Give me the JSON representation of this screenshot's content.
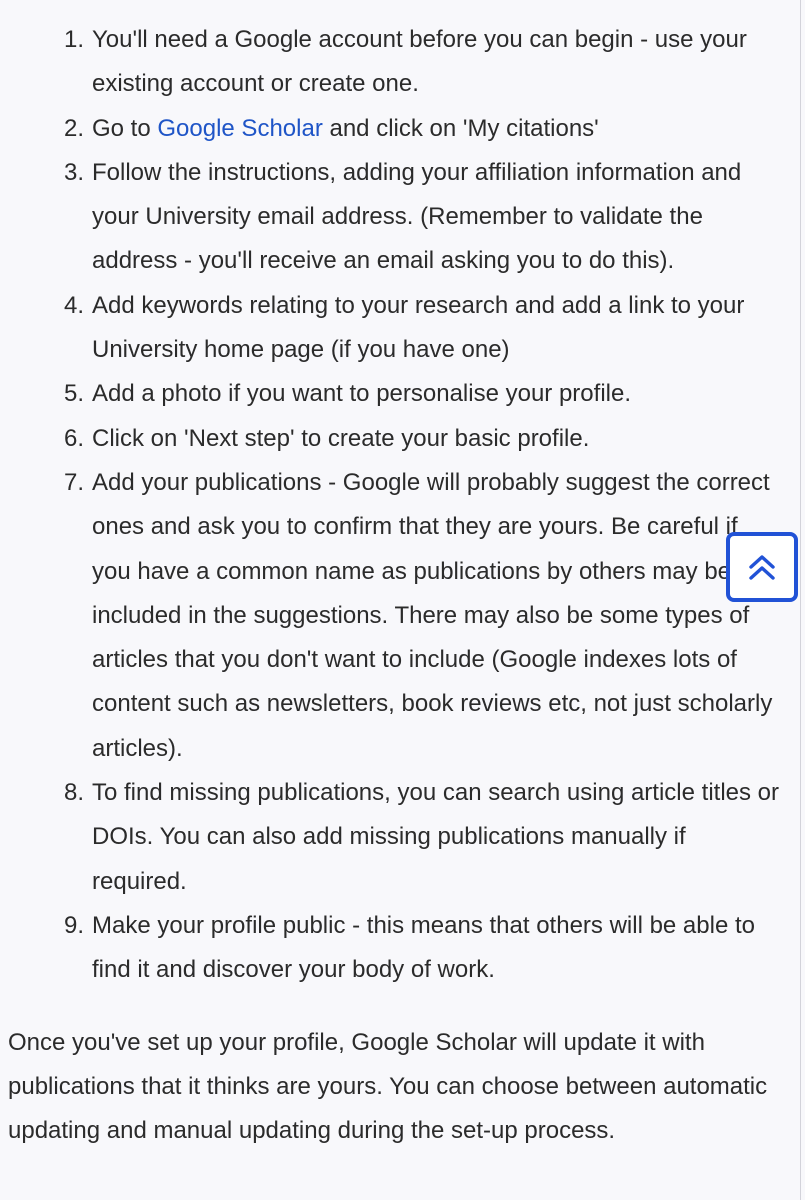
{
  "steps": [
    {
      "number": "1.",
      "text": "You'll need a Google account before you can begin - use your existing account or create one."
    },
    {
      "number": "2.",
      "before": "Go to ",
      "link": "Google Scholar",
      "after": " and click on 'My citations'"
    },
    {
      "number": "3.",
      "text": "Follow the instructions, adding your affiliation information and your University email address. (Remember to validate the address - you'll receive an email asking you to do this)."
    },
    {
      "number": "4.",
      "text": "Add keywords relating to your research and add a link to your University home page (if you have one)"
    },
    {
      "number": "5.",
      "text": "Add a photo if you want to personalise your profile."
    },
    {
      "number": "6.",
      "text": "Click on 'Next step' to create your basic profile."
    },
    {
      "number": "7.",
      "text": "Add your publications - Google will probably suggest the correct ones and ask you to confirm that they are yours. Be careful if you have a common name as publications by others may be included in the suggestions. There may also be some types of articles that you don't want to include (Google indexes lots of content such as newsletters, book reviews etc, not just scholarly articles)."
    },
    {
      "number": "8.",
      "text": "To find missing publications, you can search using article titles or DOIs. You can also add missing publications manually if required."
    },
    {
      "number": "9.",
      "text": "Make your profile public - this means that others will be able to find it and discover your body of work."
    }
  ],
  "note": "Once you've set up your profile, Google Scholar will update it with publications that it thinks are yours. You can choose between automatic updating and manual updating during the set-up process.",
  "back_to_top": {
    "icon": "double-chevron-up-icon"
  },
  "colors": {
    "link": "#1f55c7",
    "accent": "#2152d6",
    "text": "#2b2b2b",
    "background": "#f8f8fb"
  }
}
